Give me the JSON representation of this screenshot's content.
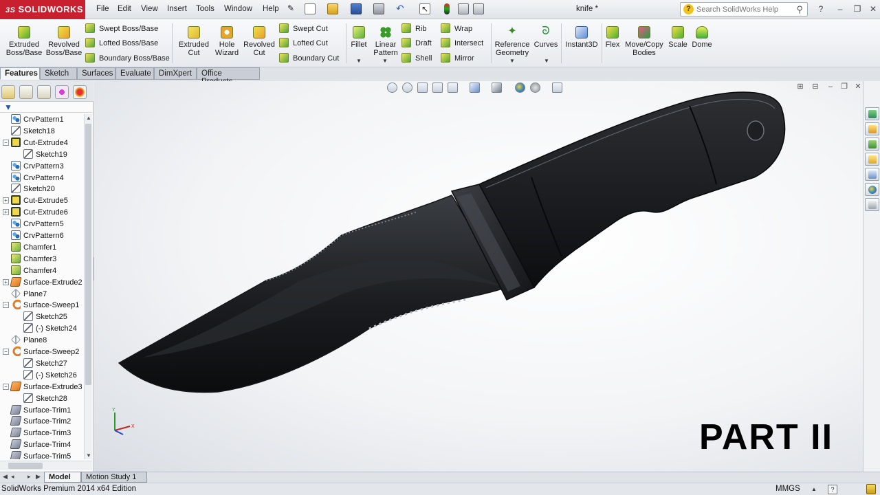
{
  "app": {
    "brand": "SOLIDWORKS",
    "brand_prefix": "3S",
    "document_title": "knife *",
    "search_placeholder": "Search SolidWorks Help",
    "status_text": "SolidWorks Premium 2014 x64 Edition",
    "units": "MMGS",
    "overlay_text": "PART II",
    "accent_color": "#c8202e"
  },
  "menu": [
    "File",
    "Edit",
    "View",
    "Insert",
    "Tools",
    "Window",
    "Help"
  ],
  "ribbon": {
    "extruded_boss": "Extruded Boss/Base",
    "revolved_boss": "Revolved Boss/Base",
    "swept_boss": "Swept Boss/Base",
    "lofted_boss": "Lofted Boss/Base",
    "boundary_boss": "Boundary Boss/Base",
    "extruded_cut": "Extruded Cut",
    "hole_wizard": "Hole Wizard",
    "revolved_cut": "Revolved Cut",
    "swept_cut": "Swept Cut",
    "lofted_cut": "Lofted Cut",
    "boundary_cut": "Boundary Cut",
    "fillet": "Fillet",
    "linear_pattern": "Linear Pattern",
    "rib": "Rib",
    "draft": "Draft",
    "shell": "Shell",
    "wrap": "Wrap",
    "intersect": "Intersect",
    "mirror": "Mirror",
    "reference_geometry": "Reference Geometry",
    "curves": "Curves",
    "instant3d": "Instant3D",
    "flex": "Flex",
    "move_copy_bodies": "Move/Copy Bodies",
    "scale": "Scale",
    "dome": "Dome"
  },
  "tabs": [
    "Features",
    "Sketch",
    "Surfaces",
    "Evaluate",
    "DimXpert",
    "Office Products"
  ],
  "feature_tree": [
    {
      "label": "CrvPattern1",
      "icon": "pattern",
      "indent": 1,
      "expand": ""
    },
    {
      "label": "Sketch18",
      "icon": "sketch",
      "indent": 1,
      "expand": ""
    },
    {
      "label": "Cut-Extrude4",
      "icon": "cut",
      "indent": 1,
      "expand": "−"
    },
    {
      "label": "Sketch19",
      "icon": "sketch",
      "indent": 2,
      "expand": ""
    },
    {
      "label": "CrvPattern3",
      "icon": "pattern",
      "indent": 1,
      "expand": ""
    },
    {
      "label": "CrvPattern4",
      "icon": "pattern",
      "indent": 1,
      "expand": ""
    },
    {
      "label": "Sketch20",
      "icon": "sketch",
      "indent": 1,
      "expand": ""
    },
    {
      "label": "Cut-Extrude5",
      "icon": "cut",
      "indent": 1,
      "expand": "+"
    },
    {
      "label": "Cut-Extrude6",
      "icon": "cut",
      "indent": 1,
      "expand": "+"
    },
    {
      "label": "CrvPattern5",
      "icon": "pattern",
      "indent": 1,
      "expand": ""
    },
    {
      "label": "CrvPattern6",
      "icon": "pattern",
      "indent": 1,
      "expand": ""
    },
    {
      "label": "Chamfer1",
      "icon": "chamfer",
      "indent": 1,
      "expand": ""
    },
    {
      "label": "Chamfer3",
      "icon": "chamfer",
      "indent": 1,
      "expand": ""
    },
    {
      "label": "Chamfer4",
      "icon": "chamfer",
      "indent": 1,
      "expand": ""
    },
    {
      "label": "Surface-Extrude2",
      "icon": "surf",
      "indent": 1,
      "expand": "+"
    },
    {
      "label": "Plane7",
      "icon": "plane",
      "indent": 1,
      "expand": ""
    },
    {
      "label": "Surface-Sweep1",
      "icon": "sweep",
      "indent": 1,
      "expand": "−"
    },
    {
      "label": "Sketch25",
      "icon": "sketch",
      "indent": 2,
      "expand": ""
    },
    {
      "label": "(-) Sketch24",
      "icon": "sketch",
      "indent": 2,
      "expand": ""
    },
    {
      "label": "Plane8",
      "icon": "plane",
      "indent": 1,
      "expand": ""
    },
    {
      "label": "Surface-Sweep2",
      "icon": "sweep",
      "indent": 1,
      "expand": "−"
    },
    {
      "label": "Sketch27",
      "icon": "sketch",
      "indent": 2,
      "expand": ""
    },
    {
      "label": "(-) Sketch26",
      "icon": "sketch",
      "indent": 2,
      "expand": ""
    },
    {
      "label": "Surface-Extrude3",
      "icon": "surf",
      "indent": 1,
      "expand": "−"
    },
    {
      "label": "Sketch28",
      "icon": "sketch",
      "indent": 2,
      "expand": ""
    },
    {
      "label": "Surface-Trim1",
      "icon": "trim",
      "indent": 1,
      "expand": ""
    },
    {
      "label": "Surface-Trim2",
      "icon": "trim",
      "indent": 1,
      "expand": ""
    },
    {
      "label": "Surface-Trim3",
      "icon": "trim",
      "indent": 1,
      "expand": ""
    },
    {
      "label": "Surface-Trim4",
      "icon": "trim",
      "indent": 1,
      "expand": ""
    },
    {
      "label": "Surface-Trim5",
      "icon": "trim",
      "indent": 1,
      "expand": ""
    }
  ],
  "bottom_tabs": [
    "Model",
    "Motion Study 1"
  ]
}
